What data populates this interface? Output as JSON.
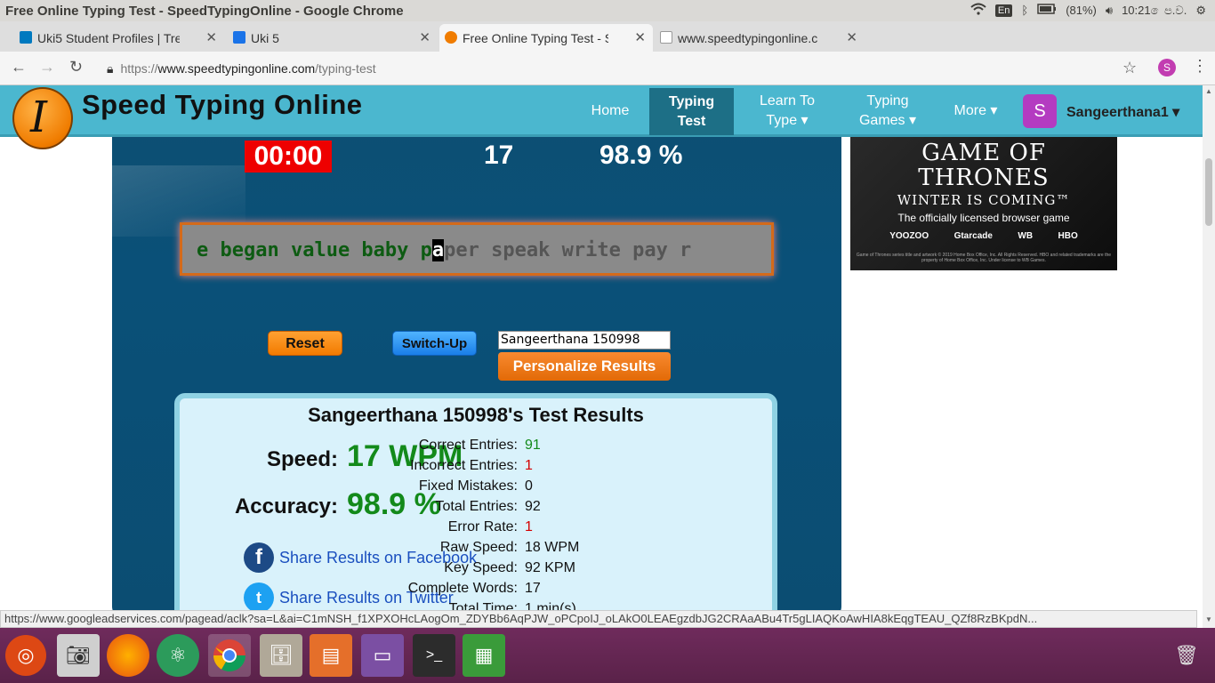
{
  "system": {
    "window_title": "Free Online Typing Test - SpeedTypingOnline - Google Chrome",
    "lang": "En",
    "battery": "(81%)",
    "clock": "10:21 ෙප.ව."
  },
  "tabs": [
    {
      "label": "Uki5 Student Profiles | Tre",
      "color": "#0079bf"
    },
    {
      "label": "Uki 5",
      "color": "#1a73e8"
    },
    {
      "label": "Free Online Typing Test - S",
      "color": "#f07c00"
    },
    {
      "label": "www.speedtypingonline.c",
      "color": "#999999"
    }
  ],
  "address": {
    "scheme": "https://",
    "host": "www.speedtypingonline.com",
    "path": "/typing-test",
    "profile_initial": "S"
  },
  "site": {
    "logo_letter": "I",
    "logo_text": "Speed Typing Online",
    "nav": [
      {
        "label": "Home"
      },
      {
        "label": "Typing Test"
      },
      {
        "label": "Learn To Type ▾"
      },
      {
        "label": "Typing Games ▾"
      },
      {
        "label": "More ▾"
      }
    ],
    "user_initial": "S",
    "user_name": "Sangeerthana1 ▾"
  },
  "test": {
    "timer": "00:00",
    "wpm": "17",
    "accuracy": "98.9 %",
    "typed": "e began value baby p",
    "cursor": "a",
    "remaining": "per speak write pay r"
  },
  "controls": {
    "reset": "Reset",
    "switch_up": "Switch-Up",
    "name_value": "Sangeerthana 150998",
    "personalize": "Personalize Results"
  },
  "results": {
    "title": "Sangeerthana 150998's Test Results",
    "speed_label": "Speed:",
    "speed_value": "17 WPM",
    "accuracy_label": "Accuracy:",
    "accuracy_value": "98.9 %",
    "share_facebook": "Share Results on Facebook",
    "share_twitter": "Share Results on Twitter",
    "stats": [
      {
        "label": "Correct Entries:",
        "value": "91",
        "color": "#138a1a"
      },
      {
        "label": "Incorrect Entries:",
        "value": "1",
        "color": "#d40000"
      },
      {
        "label": "Fixed Mistakes:",
        "value": "0",
        "color": "#111111"
      },
      {
        "label": "Total Entries:",
        "value": "92",
        "color": "#111111"
      },
      {
        "label": "Error Rate:",
        "value": "1",
        "color": "#d40000"
      },
      {
        "label": "Raw Speed:",
        "value": "18 WPM",
        "color": "#111111"
      },
      {
        "label": "Key Speed:",
        "value": "92 KPM",
        "color": "#111111"
      },
      {
        "label": "Complete Words:",
        "value": "17",
        "color": "#111111"
      },
      {
        "label": "Total Time:",
        "value": "1 min(s)",
        "color": "#111111"
      }
    ]
  },
  "ad": {
    "headline_1": "GAME OF",
    "headline_2": "THRONES",
    "tagline": "WINTER IS COMING™",
    "sub": "The officially licensed browser game",
    "logos": [
      "YOOZOO",
      "Gtarcade",
      "WB",
      "HBO"
    ],
    "fine_print": "Game of Thrones series title and artwork © 2019 Home Box Office, Inc. All Rights Reserved. HBO and related trademarks are the property of Home Box Office, Inc. Under license to WB Games."
  },
  "status_url": "https://www.googleadservices.com/pagead/aclk?sa=L&ai=C1mNSH_f1XPXOHcLAogOm_ZDYBb6AqPJW_oPCpoIJ_oLAkO0LEAEgzdbJG2CRAaABu4Tr5gLIAQKoAwHIA8kEqgTEAU_QZf8RzBKpdN..."
}
